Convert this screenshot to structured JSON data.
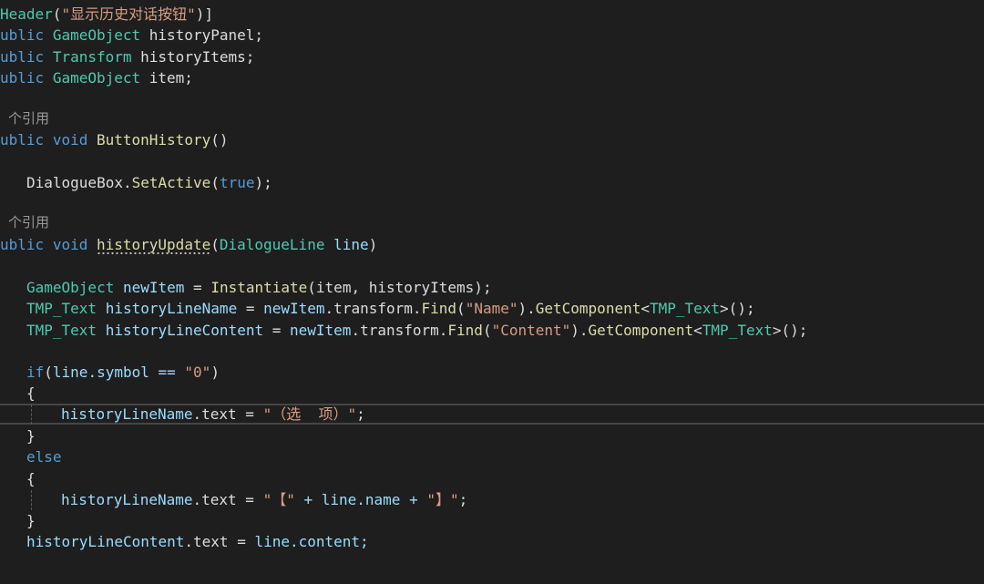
{
  "code": {
    "attr_kw": "Header",
    "attr_open": "(",
    "attr_string": "\"显示历史对话按钮\"",
    "attr_close": ")]",
    "pub": "ublic",
    "t_gameobject": "GameObject",
    "t_transform": "Transform",
    "t_tmp": "TMP_Text",
    "t_dialogueline": "DialogueLine",
    "f_history_panel": " historyPanel;",
    "f_history_items": " historyItems;",
    "f_item": " item;",
    "refs_label": " 个引用",
    "kw_void": "void",
    "m_button_history": "ButtonHistory",
    "parens": "()",
    "dialogue_box": "DialogueBox",
    "dot": ".",
    "m_set_active": "SetActive",
    "kw_true": "true",
    "close_semi": ");",
    "m_history_update": "historyUpdate",
    "v_line": "line",
    "v_new_item": "newItem",
    "m_instantiate": "Instantiate",
    "instantiate_args": "(item, historyItems);",
    "v_history_line_name": "historyLineName",
    "v_history_line_content": "historyLineContent",
    "transform_find": ".transform.",
    "m_find": "Find",
    "s_name": "\"Name\"",
    "s_content": "\"Content\"",
    "m_get_component": "GetComponent",
    "kw_if": "if",
    "symbol_expr": "line.symbol == ",
    "s_zero": "\"0\"",
    "brace_open": "{",
    "brace_close": "}",
    "kw_else": "else",
    "text_assign": ".text = ",
    "s_option": "\"（选  项）\"",
    "s_bracket_open": "\"【\"",
    "plus_line_name": " + line.name + ",
    "s_bracket_close": "\"】\"",
    "line_content": "line.content;"
  }
}
